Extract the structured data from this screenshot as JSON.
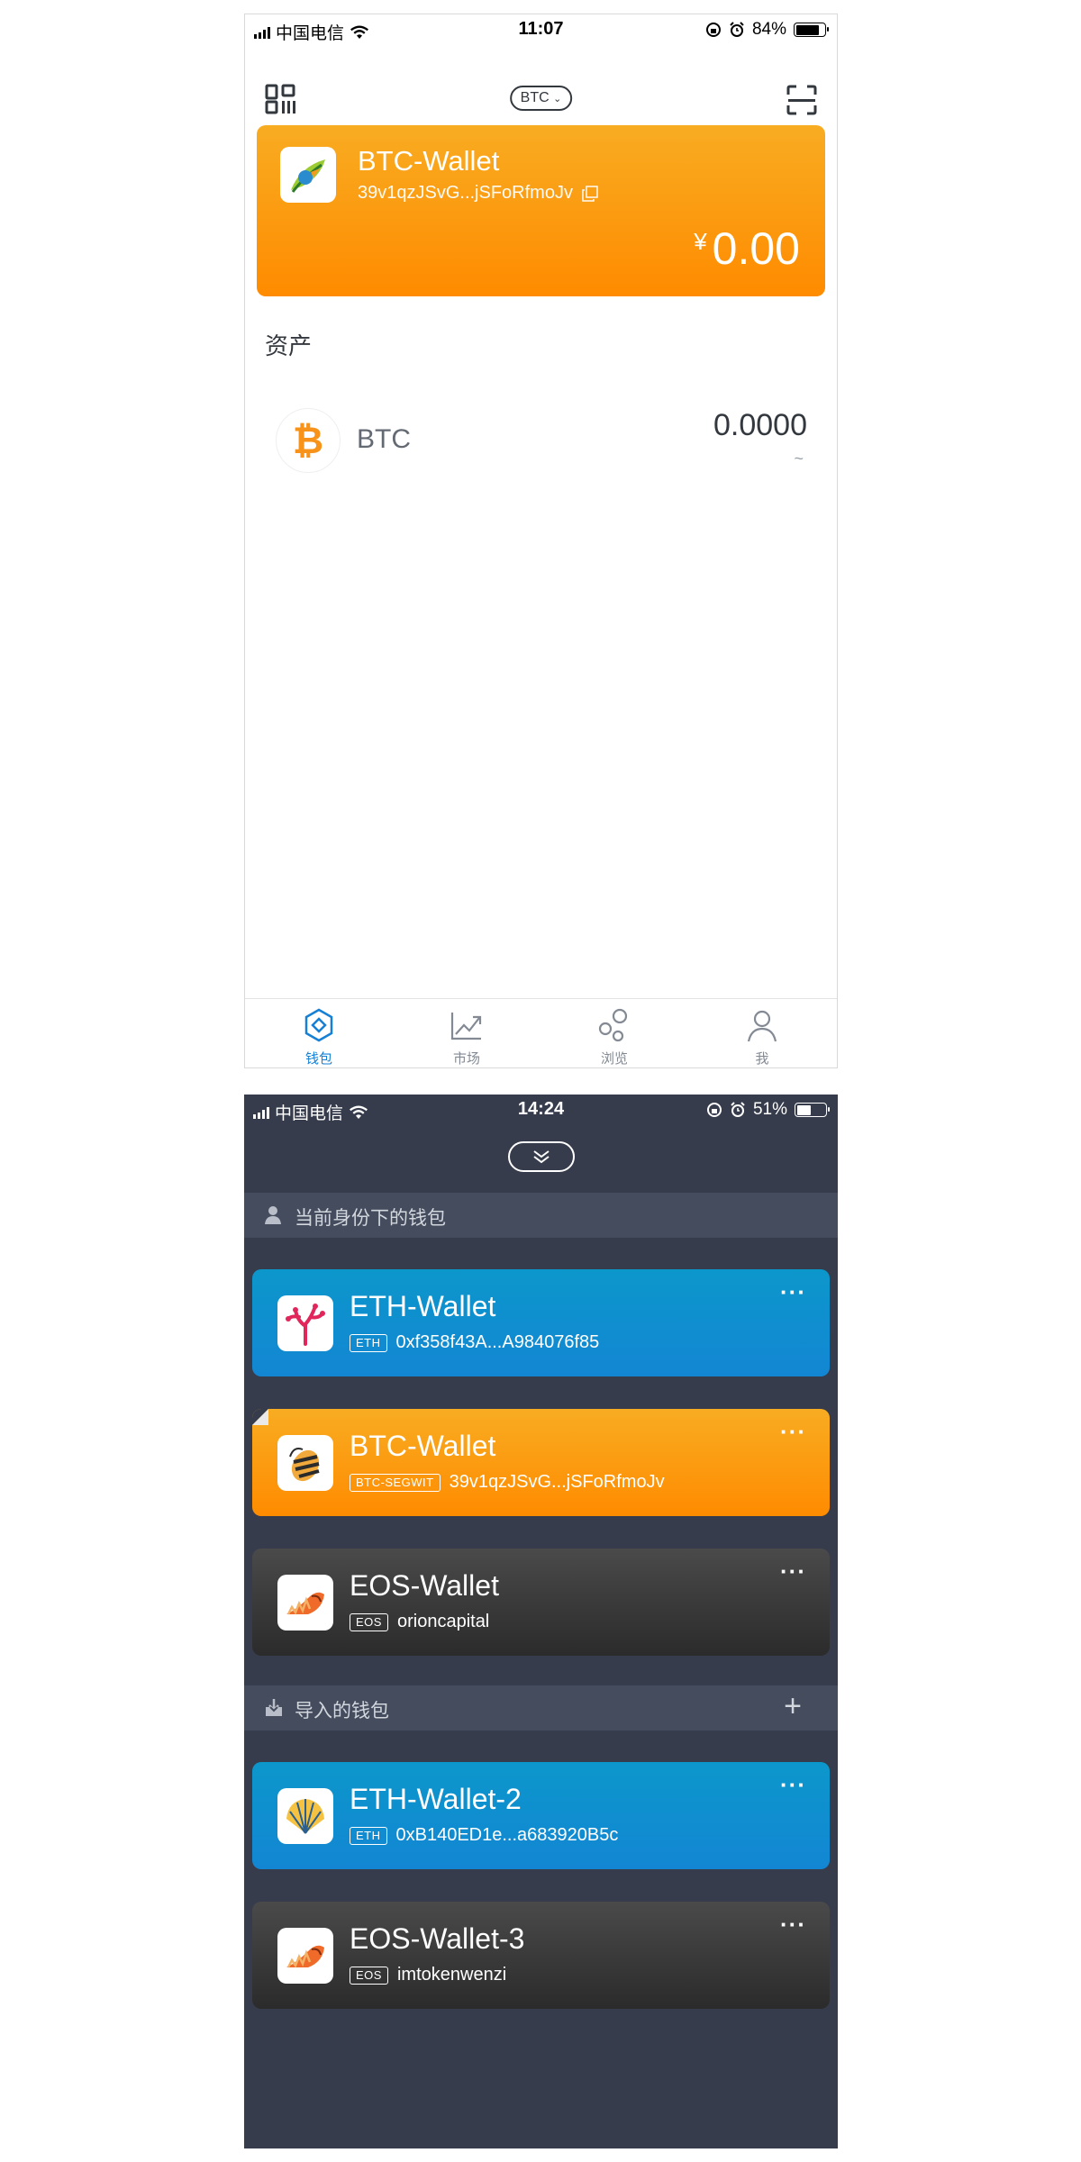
{
  "phone1": {
    "status": {
      "carrier": "中国电信",
      "time": "11:07",
      "battery_pct": "84%",
      "battery_level": 0.84
    },
    "coin_selector": "BTC",
    "wallet": {
      "name": "BTC-Wallet",
      "address": "39v1qzJSvG...jSFoRfmoJv",
      "currency_symbol": "¥",
      "balance": "0.00"
    },
    "assets_title": "资产",
    "assets": [
      {
        "symbol": "BTC",
        "amount": "0.0000",
        "fiat": "~"
      }
    ],
    "tabs": [
      {
        "label": "钱包",
        "icon": "wallet-icon",
        "active": true
      },
      {
        "label": "市场",
        "icon": "market-chart-icon",
        "active": false
      },
      {
        "label": "浏览",
        "icon": "browse-icon",
        "active": false
      },
      {
        "label": "我",
        "icon": "profile-icon",
        "active": false
      }
    ],
    "colors": {
      "accent": "#1680d6",
      "wallet_orange": "#ff8b00"
    }
  },
  "phone2": {
    "status": {
      "carrier": "中国电信",
      "time": "14:24",
      "battery_pct": "51%",
      "battery_level": 0.51
    },
    "group_identity": "当前身份下的钱包",
    "group_imported": "导入的钱包",
    "more": "···",
    "add": "+",
    "identity_wallets": [
      {
        "name": "ETH-Wallet",
        "tag": "ETH",
        "address": "0xf358f43A...A984076f85",
        "type": "eth"
      },
      {
        "name": "BTC-Wallet",
        "tag": "BTC-SEGWIT",
        "address": "39v1qzJSvG...jSFoRfmoJv",
        "type": "btc"
      },
      {
        "name": "EOS-Wallet",
        "tag": "EOS",
        "address": "orioncapital",
        "type": "eos"
      }
    ],
    "imported_wallets": [
      {
        "name": "ETH-Wallet-2",
        "tag": "ETH",
        "address": "0xB140ED1e...a683920B5c",
        "type": "eth"
      },
      {
        "name": "EOS-Wallet-3",
        "tag": "EOS",
        "address": "imtokenwenzi",
        "type": "eos"
      }
    ],
    "colors": {
      "background": "#363c4c",
      "eth_blue": "#0c97cb",
      "btc_orange": "#ff8b00",
      "eos_dark": "#2b2b2b"
    }
  }
}
